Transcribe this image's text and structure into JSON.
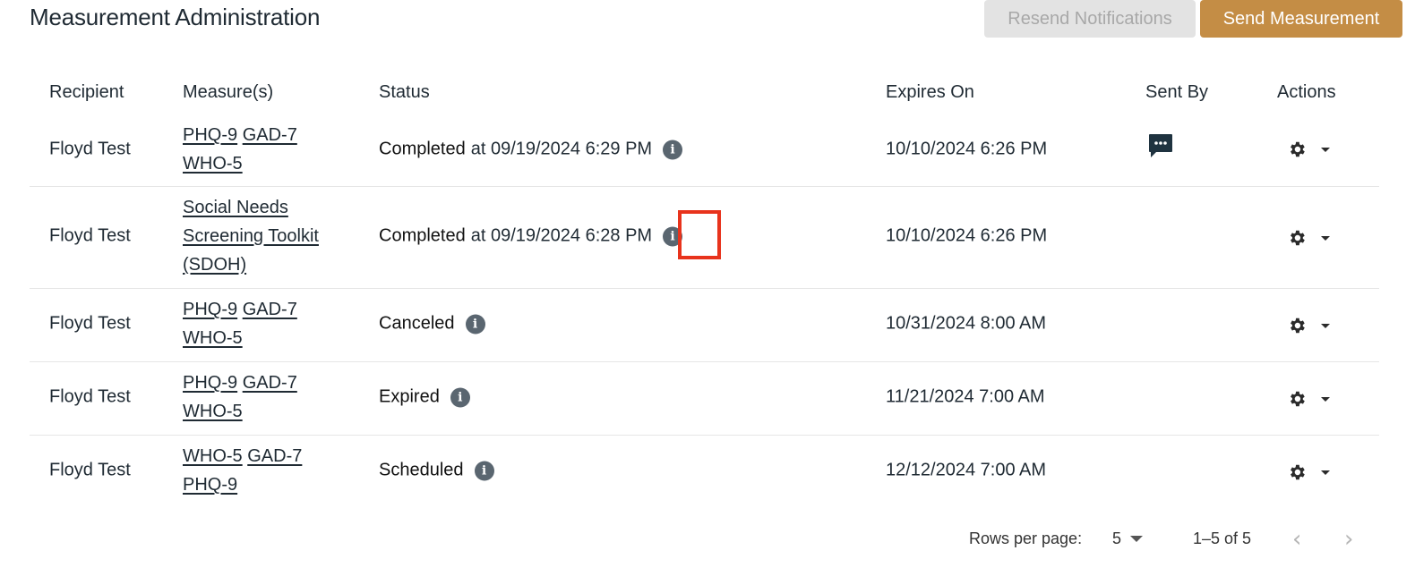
{
  "header": {
    "title": "Measurement Administration",
    "resend_label": "Resend Notifications",
    "send_label": "Send Measurement"
  },
  "table": {
    "columns": [
      "Recipient",
      "Measure(s)",
      "Status",
      "Expires On",
      "Sent By",
      "Actions"
    ],
    "rows": [
      {
        "recipient": "Floyd Test",
        "measures": [
          "PHQ-9",
          "GAD-7",
          "WHO-5"
        ],
        "status": "Completed",
        "status_detail": "at 09/19/2024 6:29 PM",
        "expires": "10/10/2024 6:26 PM",
        "sent_by_icon": "chat-icon"
      },
      {
        "recipient": "Floyd Test",
        "measures": [
          "Social Needs Screening Toolkit (SDOH)"
        ],
        "status": "Completed",
        "status_detail": "at 09/19/2024 6:28 PM",
        "expires": "10/10/2024 6:26 PM"
      },
      {
        "recipient": "Floyd Test",
        "measures": [
          "PHQ-9",
          "GAD-7",
          "WHO-5"
        ],
        "status": "Canceled",
        "expires": "10/31/2024 8:00 AM"
      },
      {
        "recipient": "Floyd Test",
        "measures": [
          "PHQ-9",
          "GAD-7",
          "WHO-5"
        ],
        "status": "Expired",
        "expires": "11/21/2024 7:00 AM"
      },
      {
        "recipient": "Floyd Test",
        "measures": [
          "WHO-5",
          "GAD-7",
          "PHQ-9"
        ],
        "status": "Scheduled",
        "expires": "12/12/2024 7:00 AM"
      }
    ]
  },
  "pagination": {
    "rows_per_page_label": "Rows per page:",
    "rows_per_page": "5",
    "range": "1–5 of 5"
  },
  "colors": {
    "accent": "#c48d45",
    "disabled_button": "#e3e3e3",
    "info_icon": "#5a6670",
    "highlight": "#e8331c"
  }
}
